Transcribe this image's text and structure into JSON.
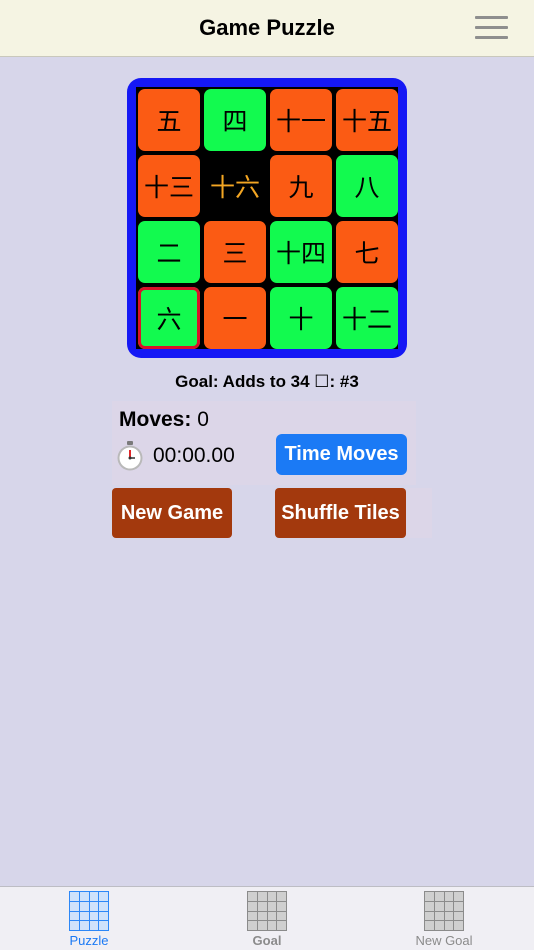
{
  "header": {
    "title": "Game Puzzle",
    "menu_icon": "hamburger-menu-icon"
  },
  "board": {
    "rows": [
      [
        {
          "label": "五",
          "color": "orange"
        },
        {
          "label": "四",
          "color": "green"
        },
        {
          "label": "十一",
          "color": "orange"
        },
        {
          "label": "十五",
          "color": "orange"
        }
      ],
      [
        {
          "label": "十三",
          "color": "orange"
        },
        {
          "label": "十六",
          "color": "empty"
        },
        {
          "label": "九",
          "color": "orange"
        },
        {
          "label": "八",
          "color": "green"
        }
      ],
      [
        {
          "label": "二",
          "color": "green"
        },
        {
          "label": "三",
          "color": "orange"
        },
        {
          "label": "十四",
          "color": "green"
        },
        {
          "label": "七",
          "color": "orange"
        }
      ],
      [
        {
          "label": "六",
          "color": "green",
          "selected": true
        },
        {
          "label": "一",
          "color": "orange"
        },
        {
          "label": "十",
          "color": "green"
        },
        {
          "label": "十二",
          "color": "green"
        }
      ]
    ],
    "colors": {
      "frame": "#1518f5",
      "orange": "#fb5b14",
      "green": "#12fa4f",
      "empty_text": "#f3a623",
      "selected": "#d8122a"
    }
  },
  "goal": {
    "text": "Goal: Adds to 34 ☐: #3"
  },
  "stats": {
    "moves_label": "Moves:",
    "moves_value": "0",
    "timer_icon": "stopwatch-icon",
    "timer_value": "00:00.00"
  },
  "buttons": {
    "time_moves": "Time Moves",
    "new_game": "New Game",
    "shuffle_tiles": "Shuffle Tiles"
  },
  "tabbar": {
    "tabs": [
      {
        "label": "Puzzle",
        "active": true,
        "icon": "puzzle-grid-icon"
      },
      {
        "label": "Goal",
        "active": false,
        "icon": "goal-grid-icon"
      },
      {
        "label": "New Goal",
        "active": false,
        "icon": "new-goal-grid-icon"
      }
    ]
  }
}
